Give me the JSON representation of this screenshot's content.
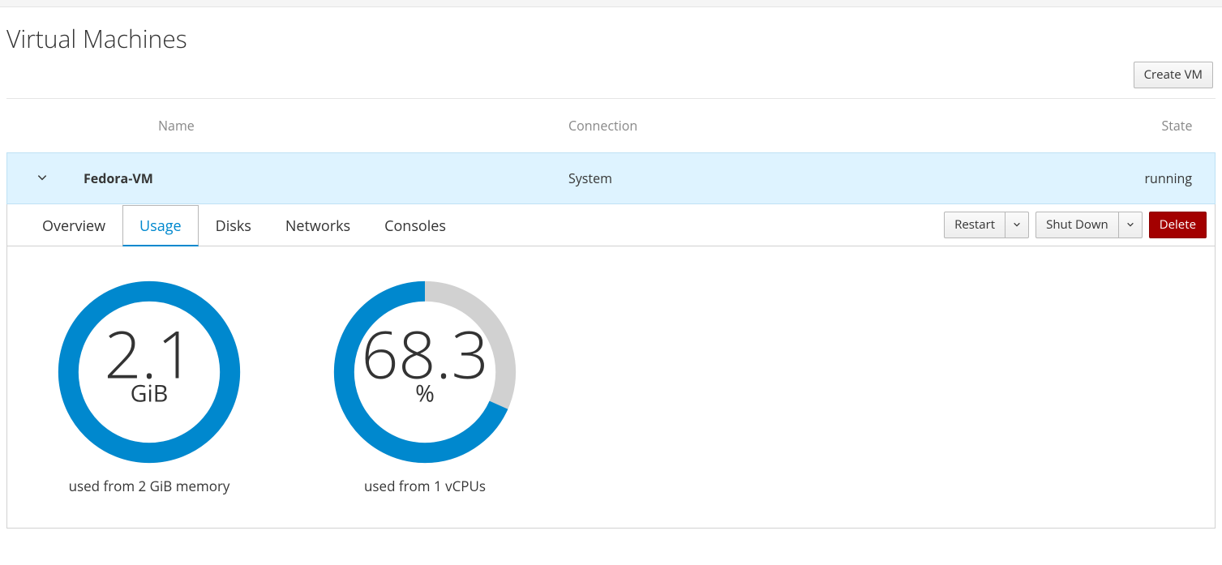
{
  "page": {
    "title": "Virtual Machines"
  },
  "toolbar": {
    "create_vm": "Create VM"
  },
  "columns": {
    "name": "Name",
    "connection": "Connection",
    "state": "State"
  },
  "vm": {
    "name": "Fedora-VM",
    "connection": "System",
    "state": "running"
  },
  "tabs": {
    "overview": "Overview",
    "usage": "Usage",
    "disks": "Disks",
    "networks": "Networks",
    "consoles": "Consoles"
  },
  "actions": {
    "restart": "Restart",
    "shutdown": "Shut Down",
    "delete": "Delete"
  },
  "colors": {
    "accent": "#0088ce",
    "track": "#d1d1d1",
    "danger": "#a30000"
  },
  "chart_data": [
    {
      "type": "donut-gauge",
      "value": 2.1,
      "unit": "GiB",
      "max": 2,
      "fraction": 1.0,
      "caption": "used from 2 GiB memory"
    },
    {
      "type": "donut-gauge",
      "value": 68.3,
      "unit": "%",
      "max": 100,
      "fraction": 0.683,
      "caption": "used from 1 vCPUs"
    }
  ]
}
